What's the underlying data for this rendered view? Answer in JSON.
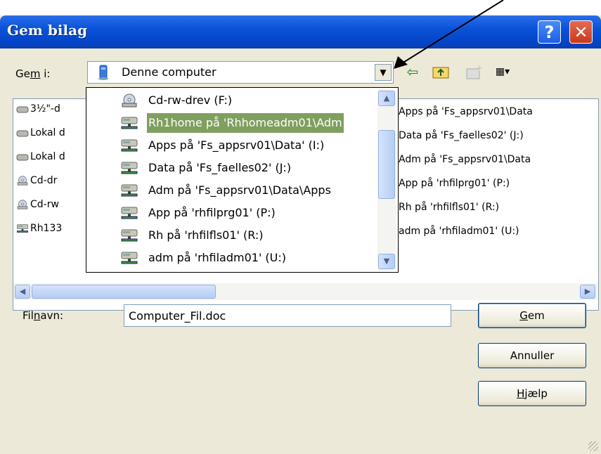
{
  "window": {
    "title": "Gem bilag",
    "help_glyph": "?",
    "close_glyph": "✕"
  },
  "lookin": {
    "label_pre": "Ge",
    "label_accel": "m",
    "label_post": " i:",
    "value": "Denne computer"
  },
  "filelist": {
    "left_items": [
      "3½\"-d",
      "Lokal d",
      "Lokal d",
      "Cd-dr",
      "Cd-rw",
      "Rh133"
    ],
    "right_items": [
      "Apps på 'Fs_appsrv01\\Data",
      "Data på 'Fs_faelles02' (J:)",
      "Adm på 'Fs_appsrv01\\Data",
      "App på 'rhfilprg01' (P:)",
      "Rh på 'rhfilfls01' (R:)",
      "adm på 'rhfiladm01' (U:)"
    ]
  },
  "dropdown": {
    "items": [
      {
        "label": "Cd-rw-drev (F:)",
        "icon": "cd-drive-icon"
      },
      {
        "label": "Rh1home på 'Rhhomeadm01\\Adm",
        "icon": "network-drive-icon"
      },
      {
        "label": "Apps på 'Fs_appsrv01\\Data' (I:)",
        "icon": "network-drive-icon"
      },
      {
        "label": "Data på 'Fs_faelles02' (J:)",
        "icon": "network-drive-icon"
      },
      {
        "label": "Adm på 'Fs_appsrv01\\Data\\Apps",
        "icon": "network-drive-icon"
      },
      {
        "label": "App på 'rhfilprg01' (P:)",
        "icon": "network-drive-icon"
      },
      {
        "label": "Rh på 'rhfilfls01' (R:)",
        "icon": "network-drive-icon"
      },
      {
        "label": "adm på 'rhfiladm01' (U:)",
        "icon": "network-drive-icon"
      }
    ],
    "selected_index": 1
  },
  "filename": {
    "label_pre": "Fil",
    "label_accel": "n",
    "label_post": "avn:",
    "value": "Computer_Fil.doc"
  },
  "buttons": {
    "save_accel": "G",
    "save_rest": "em",
    "cancel": "Annuller",
    "help_accel": "H",
    "help_rest": "jælp"
  },
  "colors": {
    "title_blue": "#0a52d8",
    "selection": "#7f9f5f",
    "dialog_bg": "#ece9d8"
  }
}
